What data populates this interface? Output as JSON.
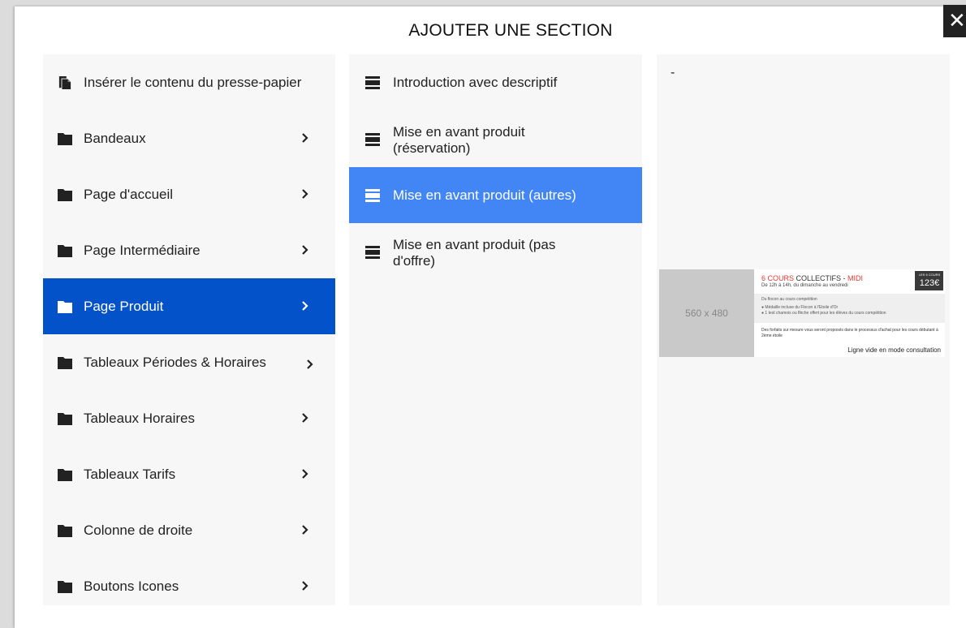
{
  "dialog": {
    "title": "AJOUTER UNE SECTION",
    "close_label": "✕"
  },
  "left_menu": {
    "items": [
      {
        "label": "Insérer le contenu du presse-papier",
        "icon": "paste-icon",
        "has_chevron": false
      },
      {
        "label": "Bandeaux",
        "icon": "folder-icon",
        "has_chevron": true
      },
      {
        "label": "Page d'accueil",
        "icon": "folder-icon",
        "has_chevron": true
      },
      {
        "label": "Page Intermédiaire",
        "icon": "folder-icon",
        "has_chevron": true
      },
      {
        "label": "Page Produit",
        "icon": "folder-icon",
        "has_chevron": true,
        "selected": true
      },
      {
        "label": "Tableaux Périodes & Horaires",
        "icon": "folder-icon",
        "has_chevron": true
      },
      {
        "label": "Tableaux Horaires",
        "icon": "folder-icon",
        "has_chevron": true
      },
      {
        "label": "Tableaux Tarifs",
        "icon": "folder-icon",
        "has_chevron": true
      },
      {
        "label": "Colonne de droite",
        "icon": "folder-icon",
        "has_chevron": true
      },
      {
        "label": "Boutons Icones",
        "icon": "folder-icon",
        "has_chevron": true
      }
    ]
  },
  "middle_menu": {
    "items": [
      {
        "label": "Introduction avec descriptif",
        "icon": "section-icon"
      },
      {
        "label": "Mise en avant produit (réservation)",
        "icon": "section-icon"
      },
      {
        "label": "Mise en avant produit (autres)",
        "icon": "section-icon",
        "selected": true
      },
      {
        "label": "Mise en avant produit (pas d'offre)",
        "icon": "section-icon"
      }
    ]
  },
  "preview": {
    "description": "-",
    "placeholder": "560 x 480",
    "title_red_1": "6 COURS",
    "title_dark": " COLLECTIFS - ",
    "title_red_2": "MIDI",
    "subtitle": "De 12h à 14h, du dimanche au vendredi",
    "price_label": "LES 6 COURS",
    "price": "123€",
    "band_line_1": "Du flocon au cours compétition",
    "band_line_2": "● Médaille incluse du Flocon à l'Etoile d'Or",
    "band_line_3": "● 1 test chamois ou flèche offert pour les élèves du cours compétition",
    "note": "Des forfaits sur mesure vous seront proposés dans le processus d'achat pour les cours débutant à 2ème étoile",
    "empty_line": "Ligne vide en mode consultation"
  },
  "colors": {
    "left_selected": "#0352c9",
    "middle_selected": "#4285f4",
    "panel_bg": "#f7f7f7"
  }
}
